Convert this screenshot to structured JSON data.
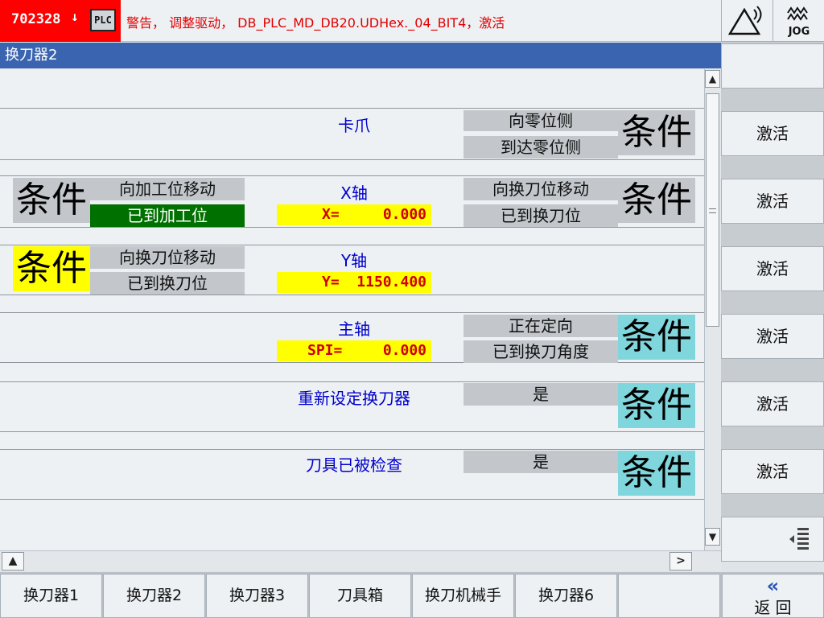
{
  "alarm": {
    "number": "702328",
    "arrow": "↓",
    "plc_badge": "PLC",
    "message": "警告， 调整驱动， DB_PLC_MD_DB20.UDHex._04_BIT4，激活"
  },
  "top_right": {
    "warning_icon": "antenna-warning-icon",
    "jog_label": "JOG"
  },
  "title": "换刀器2",
  "sections": {
    "claw": {
      "label": "卡爪",
      "status1": "向零位侧",
      "status2": "到达零位侧",
      "cond": "条件"
    },
    "x_axis": {
      "label": "X轴",
      "left_cond": "条件",
      "left_status1": "向加工位移动",
      "left_status2": "已到加工位",
      "value_name": "X=",
      "value": "0.000",
      "right_status1": "向换刀位移动",
      "right_status2": "已到换刀位",
      "right_cond": "条件"
    },
    "y_axis": {
      "label": "Y轴",
      "left_cond": "条件",
      "left_status1": "向换刀位移动",
      "left_status2": "已到换刀位",
      "value_name": "Y=",
      "value": "1150.400"
    },
    "spindle": {
      "label": "主轴",
      "value_name": "SPI=",
      "value": "0.000",
      "status1": "正在定向",
      "status2": "已到换刀角度",
      "cond": "条件"
    },
    "reset": {
      "label": "重新设定换刀器",
      "status": "是",
      "cond": "条件"
    },
    "tool_checked": {
      "label": "刀具已被检查",
      "status": "是",
      "cond": "条件"
    }
  },
  "scroll": {
    "up": "▲",
    "down": "▼",
    "left": "▲",
    "right": ">"
  },
  "vertical_softkeys": [
    "激活",
    "激活",
    "激活",
    "激活",
    "激活",
    "激活"
  ],
  "horizontal_softkeys": [
    "换刀器1",
    "换刀器2",
    "换刀器3",
    "刀具箱",
    "换刀机械手",
    "换刀器6"
  ],
  "back": {
    "chevron": "«",
    "label": "返 回"
  },
  "colors": {
    "alarm_red": "#ff0000",
    "title_blue": "#3a64b0",
    "label_blue": "#0000cc",
    "status_gray": "#c3c7cb",
    "active_green": "#007000",
    "cond_yellow": "#ffff00",
    "cond_cyan": "#7fd6dc",
    "value_red": "#d00000"
  }
}
